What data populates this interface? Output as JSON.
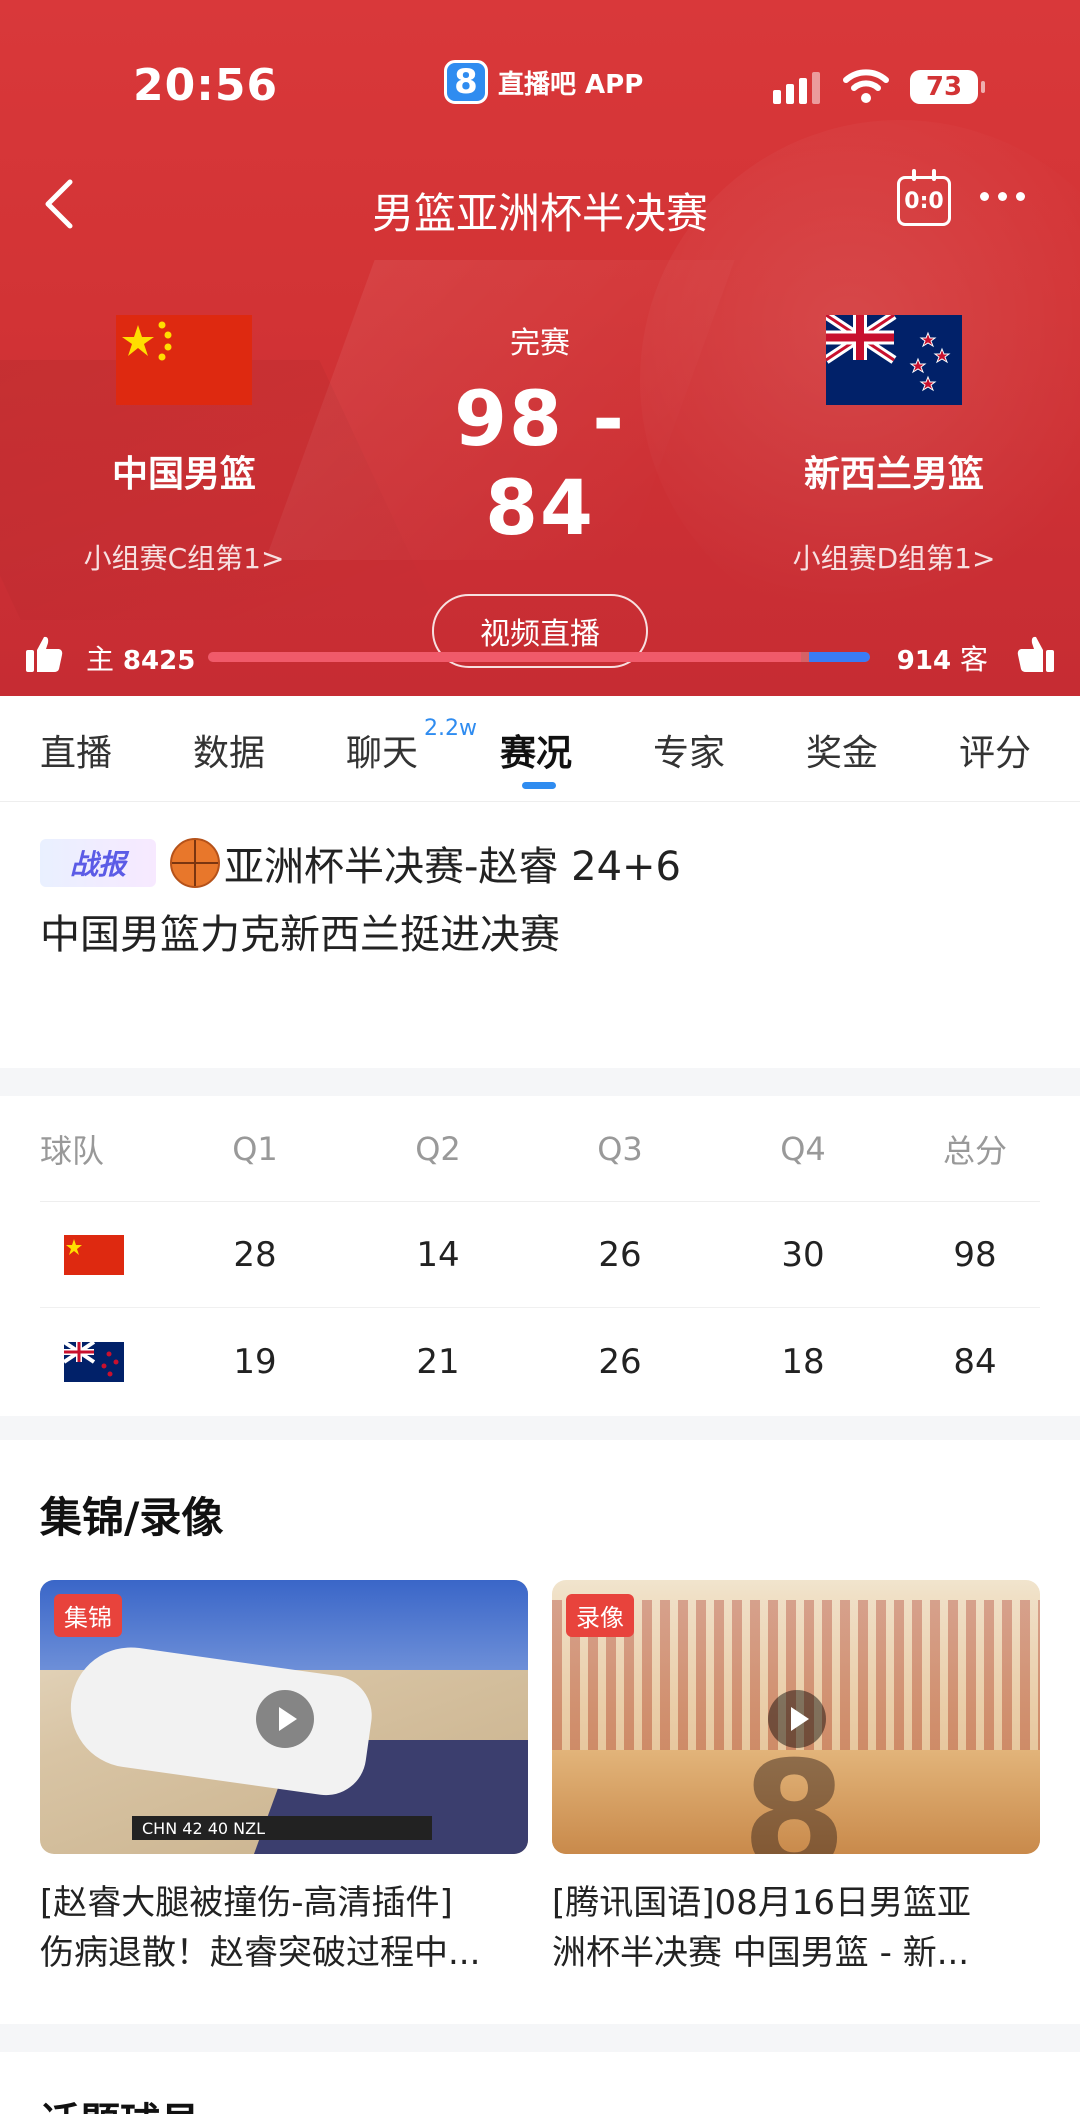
{
  "status_bar": {
    "time": "20:56",
    "app_logo": "8",
    "app_name": "直播吧 APP",
    "battery": "73"
  },
  "nav": {
    "title": "男篮亚洲杯半决赛",
    "score_icon_text": "0:0"
  },
  "match": {
    "status": "完赛",
    "score": "98 - 84",
    "live_button": "视频直播",
    "home": {
      "name": "中国男篮",
      "rank": "小组赛C组第1>"
    },
    "away": {
      "name": "新西兰男篮",
      "rank": "小组赛D组第1>"
    }
  },
  "support": {
    "home_label": "主",
    "home_count": "8425",
    "away_count": "914",
    "away_label": "客",
    "home_share": 0.902
  },
  "tabs": [
    {
      "label": "直播"
    },
    {
      "label": "数据"
    },
    {
      "label": "聊天",
      "badge": "2.2w"
    },
    {
      "label": "赛况"
    },
    {
      "label": "专家"
    },
    {
      "label": "奖金"
    },
    {
      "label": "评分"
    }
  ],
  "report": {
    "tag": "战报",
    "line1": "亚洲杯半决赛-赵睿 24+6",
    "line2": "中国男篮力克新西兰挺进决赛"
  },
  "quarter_table": {
    "headers": [
      "球队",
      "Q1",
      "Q2",
      "Q3",
      "Q4",
      "总分"
    ],
    "rows": [
      {
        "team_flag": "china-flag",
        "q1": "28",
        "q2": "14",
        "q3": "26",
        "q4": "30",
        "total": "98"
      },
      {
        "team_flag": "new-zealand-flag",
        "q1": "19",
        "q2": "21",
        "q3": "26",
        "q4": "18",
        "total": "84"
      }
    ]
  },
  "highlights": {
    "title": "集锦/录像",
    "videos": [
      {
        "tag": "集锦",
        "title_line1": "[赵睿大腿被撞伤-高清插件]",
        "title_line2": "伤病退散！赵睿突破过程中...",
        "overlay": "CHN 42 40 NZL"
      },
      {
        "tag": "录像",
        "title_line1": "[腾讯国语]08月16日男篮亚",
        "title_line2": "洲杯半决赛 中国男篮 - 新...",
        "overlay": "8"
      }
    ]
  },
  "next_section": {
    "title": "话题球员"
  },
  "colors": {
    "header_red": "#d23335",
    "accent_blue": "#2f8cf0",
    "tag_red": "#e8433c"
  }
}
